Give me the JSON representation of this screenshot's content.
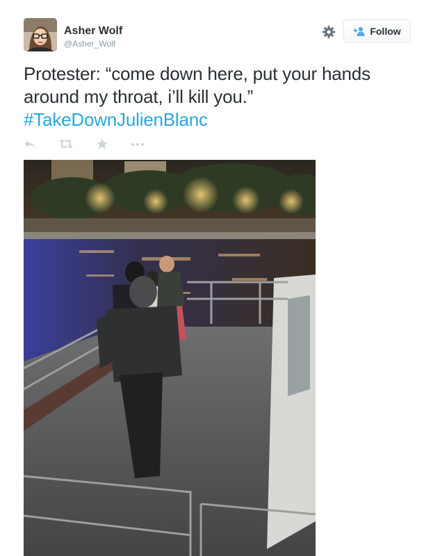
{
  "tweet": {
    "author": {
      "display_name": "Asher Wolf",
      "screen_name": "@Asher_Wolf"
    },
    "follow_button": {
      "label": "Follow"
    },
    "text": "Protester: “come down here, put your hands around my throat, i’ll kill you.”",
    "hashtag": "#TakeDownJulienBlanc",
    "actions": [
      {
        "icon": "reply-icon"
      },
      {
        "icon": "retweet-icon"
      },
      {
        "icon": "favorite-star-icon"
      },
      {
        "icon": "more-dots-icon"
      }
    ],
    "colors": {
      "hashtag": "#2aa6de",
      "icon_gray": "#ccd6dd",
      "screen_name": "#8899a6"
    }
  }
}
